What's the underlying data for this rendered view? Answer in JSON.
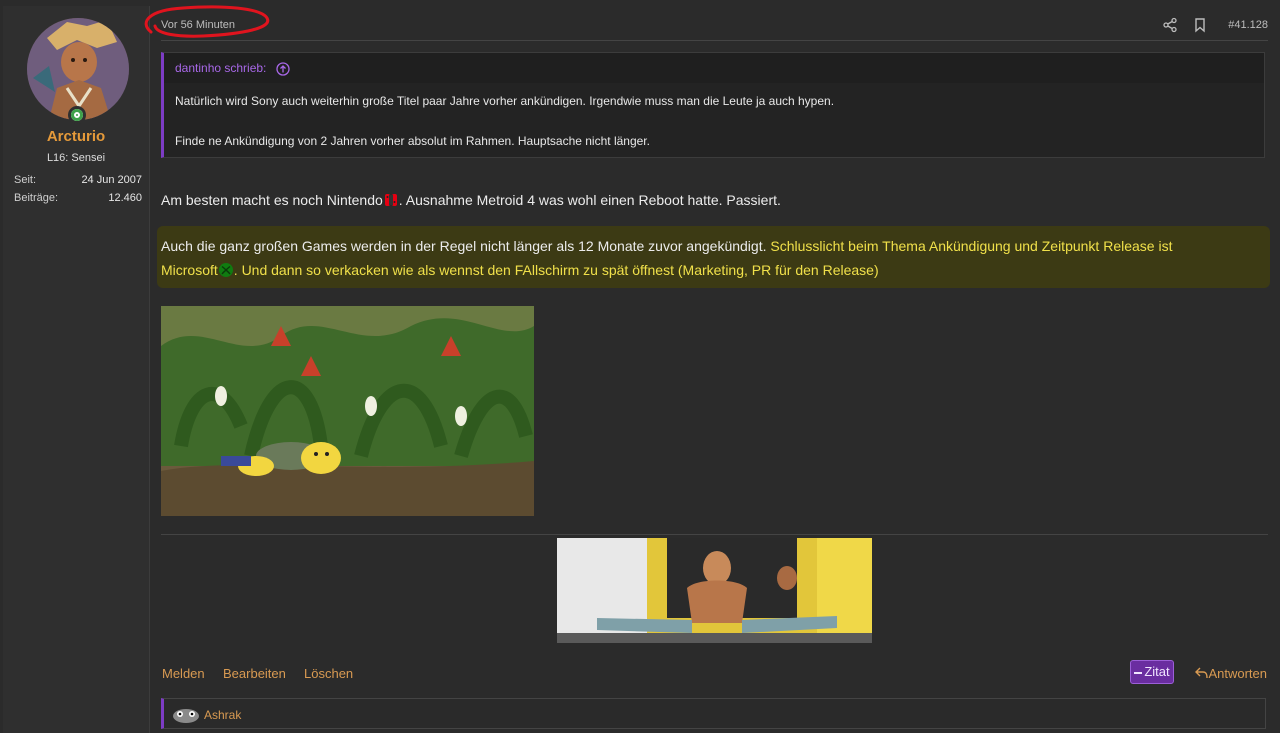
{
  "user": {
    "name": "Arcturio",
    "title": "L16: Sensei",
    "stats": [
      {
        "key": "Seit:",
        "value": "24 Jun 2007"
      },
      {
        "key": "Beiträge:",
        "value": "12.460"
      }
    ]
  },
  "post": {
    "time": "Vor 56 Minuten",
    "number": "#41.128"
  },
  "quote": {
    "author": "dantinho schrieb:",
    "lines": [
      "Natürlich wird Sony auch weiterhin große Titel paar Jahre vorher ankündigen. Irgendwie muss man die Leute ja auch hypen.",
      "Finde ne Ankündigung von 2 Jahren vorher absolut im Rahmen. Hauptsache nicht länger."
    ]
  },
  "body": {
    "p1_a": "Am besten macht es noch Nintendo",
    "p1_b": ". Ausnahme Metroid 4 was wohl einen Reboot hatte. Passiert.",
    "p2_plain": "Auch die ganz großen Games werden in der Regel nicht länger als 12 Monate zuvor angekündigt. ",
    "p2_hl_a": "Schlusslicht beim Thema Ankündigung und Zeitpunkt Release ist",
    "p2_hl_b": "Microsoft",
    "p2_hl_c": ". Und dann so verkacken wie als wennst den FAllschirm zu spät öffnest (Marketing, PR für den Release)"
  },
  "actions": {
    "report": "Melden",
    "edit": "Bearbeiten",
    "delete": "Löschen",
    "quote": "Zitat",
    "reply": "Antworten"
  },
  "reactions": {
    "names": "Ashrak"
  },
  "icons": [
    "share-icon",
    "bookmark-icon",
    "arrow-up-circle-icon",
    "reply-arrow-icon",
    "minus-icon",
    "nintendo-switch-icon",
    "xbox-icon"
  ],
  "colors": {
    "accent": "#7d3cc4",
    "username": "#e59a3a",
    "link": "#d89a52",
    "highlight": "#f0e04a"
  }
}
